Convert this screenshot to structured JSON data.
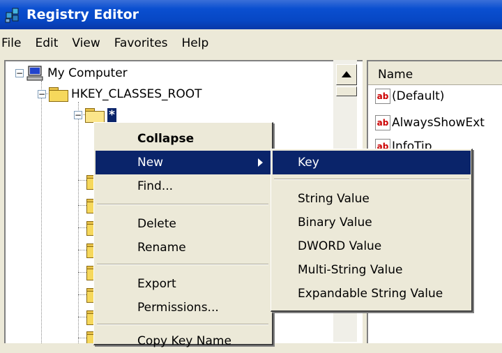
{
  "window": {
    "title": "Registry Editor"
  },
  "menubar": [
    "File",
    "Edit",
    "View",
    "Favorites",
    "Help"
  ],
  "tree": {
    "root": "My Computer",
    "hkcr": "HKEY_CLASSES_ROOT",
    "selected": "*"
  },
  "values_pane": {
    "column_name": "Name",
    "rows": [
      "(Default)",
      "AlwaysShowExt",
      "InfoTip"
    ]
  },
  "context_menu": {
    "items": [
      "Collapse",
      "New",
      "Find...",
      "Delete",
      "Rename",
      "Export",
      "Permissions...",
      "Copy Key Name"
    ]
  },
  "new_submenu": {
    "items": [
      "Key",
      "String Value",
      "Binary Value",
      "DWORD Value",
      "Multi-String Value",
      "Expandable String Value"
    ]
  },
  "colors": {
    "selection": "#0a246a",
    "title_blue": "#0747c4",
    "menu_bg": "#ece9d8"
  }
}
